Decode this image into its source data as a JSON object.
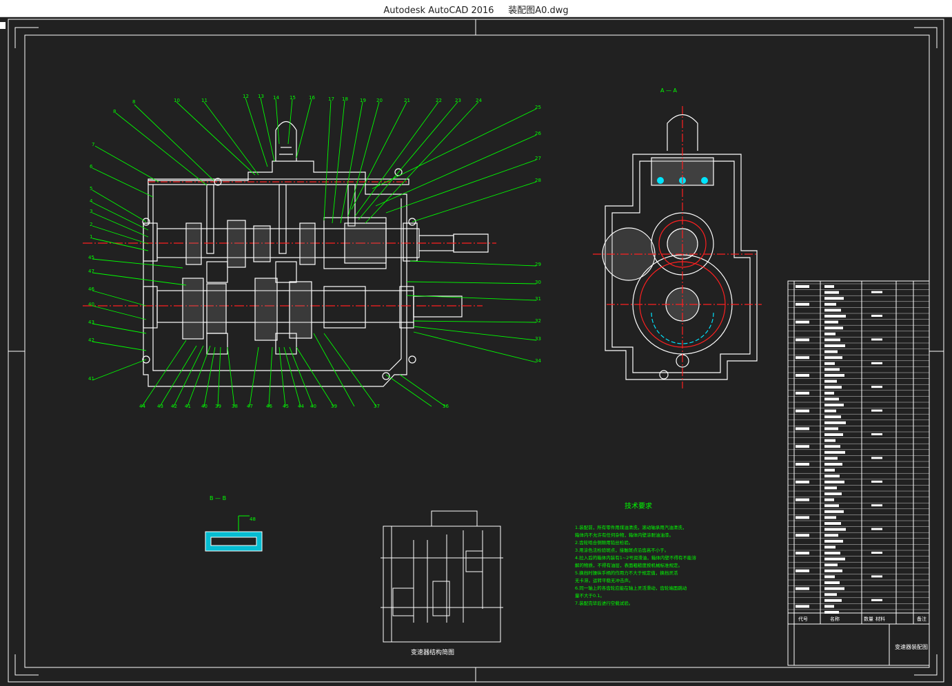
{
  "window": {
    "app_name": "Autodesk AutoCAD 2016",
    "file_name": "装配图A0.dwg",
    "title": "Autodesk AutoCAD 2016     装配图A0.dwg"
  },
  "colors": {
    "background": "#212121",
    "frame": "#ffffff",
    "leader": "#00ff00",
    "center_line": "#ff2020",
    "hatch": "#bfbfbf",
    "accent_cyan": "#00e5ff",
    "text_green": "#00ff00"
  },
  "drawing": {
    "section_aa_label": "A — A",
    "section_bb_label": "B — B",
    "tech_req_title": "技术要求",
    "tech_req_lines": [
      "1.装配前，所有零件用煤油清洗，滚动轴承用汽油清洗，",
      "  箱体内不允许有任何杂物，箱体内壁涂耐油油漆。",
      "2.齿轮啮合侧隙用铅丝检验。",
      "3.用涂色法检验斑点，接触斑点沿齿高不小于。",
      "4.拉入后的箱体内装有1~2号润滑油，箱体内壁不得有不能溶",
      "  解的物质，不得有油层，表面粗糙度按机械标准规定。",
      "5.换挡时操纵手柄的作用力不大于规定值，换挡灵活",
      "  无卡滞，运转平稳无冲击声。",
      "6.同一轴上的各齿轮应能在轴上灵活滑动，齿轮端面跳动",
      "  量不大于0.1。",
      "7.装配完毕后进行空载试验。"
    ],
    "schematic_caption": "变速器结构简图",
    "title_block_name": "变速器装配图",
    "bom_headers": [
      "代号",
      "名称",
      "数量",
      "材料",
      "备注"
    ],
    "balloons_top": [
      "9",
      "10",
      "11",
      "12",
      "13",
      "14",
      "15",
      "16",
      "17",
      "18",
      "19",
      "20",
      "21",
      "22",
      "23",
      "24"
    ],
    "balloons_left": [
      "8",
      "7",
      "6",
      "5",
      "4",
      "3",
      "2",
      "1",
      "45",
      "47",
      "46",
      "40",
      "43",
      "42",
      "41"
    ],
    "balloons_right": [
      "25",
      "26",
      "27",
      "28",
      "29",
      "30",
      "31",
      "32",
      "33",
      "34"
    ],
    "balloons_bottom": [
      "44",
      "43",
      "42",
      "41",
      "40",
      "39",
      "38",
      "47",
      "46",
      "45",
      "44",
      "40",
      "39",
      "37",
      "36"
    ],
    "section_bb_balloon": "48"
  }
}
